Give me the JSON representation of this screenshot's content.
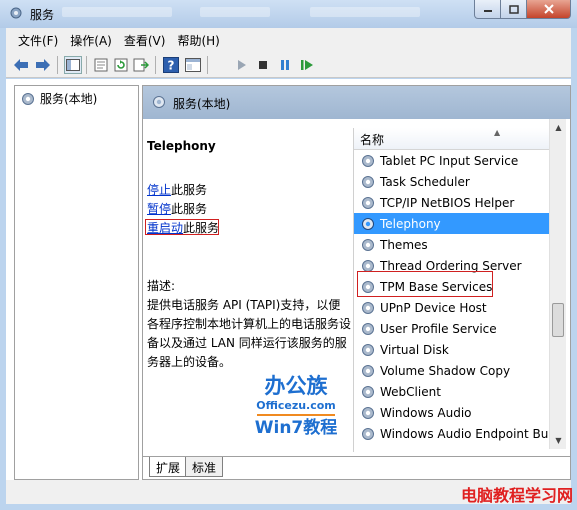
{
  "window": {
    "title": "服务"
  },
  "menu": [
    "文件(F)",
    "操作(A)",
    "查看(V)",
    "帮助(H)"
  ],
  "tree": {
    "root_label": "服务(本地)"
  },
  "panel": {
    "header_title": "服务(本地)"
  },
  "detail": {
    "service_name": "Telephony",
    "actions": [
      {
        "link": "停止",
        "suffix": "此服务"
      },
      {
        "link": "暂停",
        "suffix": "此服务"
      },
      {
        "link": "重启动",
        "suffix": "此服务"
      }
    ],
    "description_label": "描述:",
    "description": "提供电话服务 API (TAPI)支持，以便各程序控制本地计算机上的电话服务设备以及通过 LAN 同样运行该服务的服务器上的设备。"
  },
  "list": {
    "column_header": "名称",
    "rows": [
      "Tablet PC Input Service",
      "Task Scheduler",
      "TCP/IP NetBIOS Helper",
      "Telephony",
      "Themes",
      "Thread Ordering Server",
      "TPM Base Services",
      "UPnP Device Host",
      "User Profile Service",
      "Virtual Disk",
      "Volume Shadow Copy",
      "WebClient",
      "Windows Audio",
      "Windows Audio Endpoint Bui"
    ],
    "selected_row": "Telephony"
  },
  "tabs": [
    "扩展",
    "标准"
  ],
  "watermark": {
    "brand": "办公族",
    "site": "Officezu.com",
    "tag": "Win7教程"
  },
  "site_mark": "电脑教程学习网",
  "colors": {
    "selection": "#3399ff",
    "highlight_border": "#d02020",
    "link": "#0033cc"
  },
  "icons": [
    "services-gear-icon",
    "back-arrow-icon",
    "forward-arrow-icon",
    "show-hide-tree-icon",
    "properties-icon",
    "refresh-icon",
    "export-list-icon",
    "help-icon",
    "console-view-icon",
    "start-service-icon",
    "stop-service-icon",
    "pause-service-icon",
    "restart-service-icon"
  ]
}
